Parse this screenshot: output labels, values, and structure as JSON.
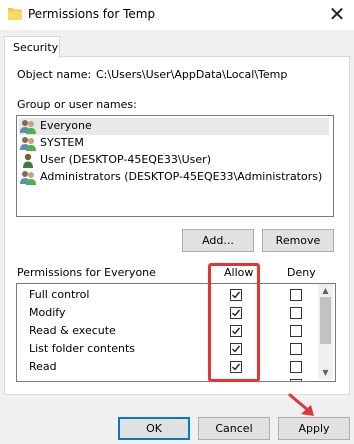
{
  "window": {
    "title": "Permissions for Temp",
    "close_symbol": "✕"
  },
  "tabs": [
    {
      "label": "Security",
      "active": true
    }
  ],
  "object": {
    "label": "Object name:",
    "value": "C:\\Users\\User\\AppData\\Local\\Temp"
  },
  "groups": {
    "label": "Group or user names:",
    "items": [
      {
        "name": "Everyone",
        "icon": "users-group-icon",
        "selected": true
      },
      {
        "name": "SYSTEM",
        "icon": "users-group-icon",
        "selected": false
      },
      {
        "name": "User (DESKTOP-45EQE33\\User)",
        "icon": "user-icon",
        "selected": false
      },
      {
        "name": "Administrators (DESKTOP-45EQE33\\Administrators)",
        "icon": "users-group-icon",
        "selected": false
      }
    ],
    "add_label": "Add...",
    "remove_label": "Remove"
  },
  "permissions": {
    "label": "Permissions for Everyone",
    "allow_header": "Allow",
    "deny_header": "Deny",
    "rows": [
      {
        "name": "Full control",
        "allow": true,
        "deny": false
      },
      {
        "name": "Modify",
        "allow": true,
        "deny": false
      },
      {
        "name": "Read & execute",
        "allow": true,
        "deny": false
      },
      {
        "name": "List folder contents",
        "allow": true,
        "deny": false
      },
      {
        "name": "Read",
        "allow": true,
        "deny": false
      }
    ]
  },
  "buttons": {
    "ok": "OK",
    "cancel": "Cancel",
    "apply": "Apply"
  },
  "colors": {
    "highlight_box": "#e0363a",
    "selection": "#e8e8e8",
    "default_button_border": "#0078d7"
  }
}
